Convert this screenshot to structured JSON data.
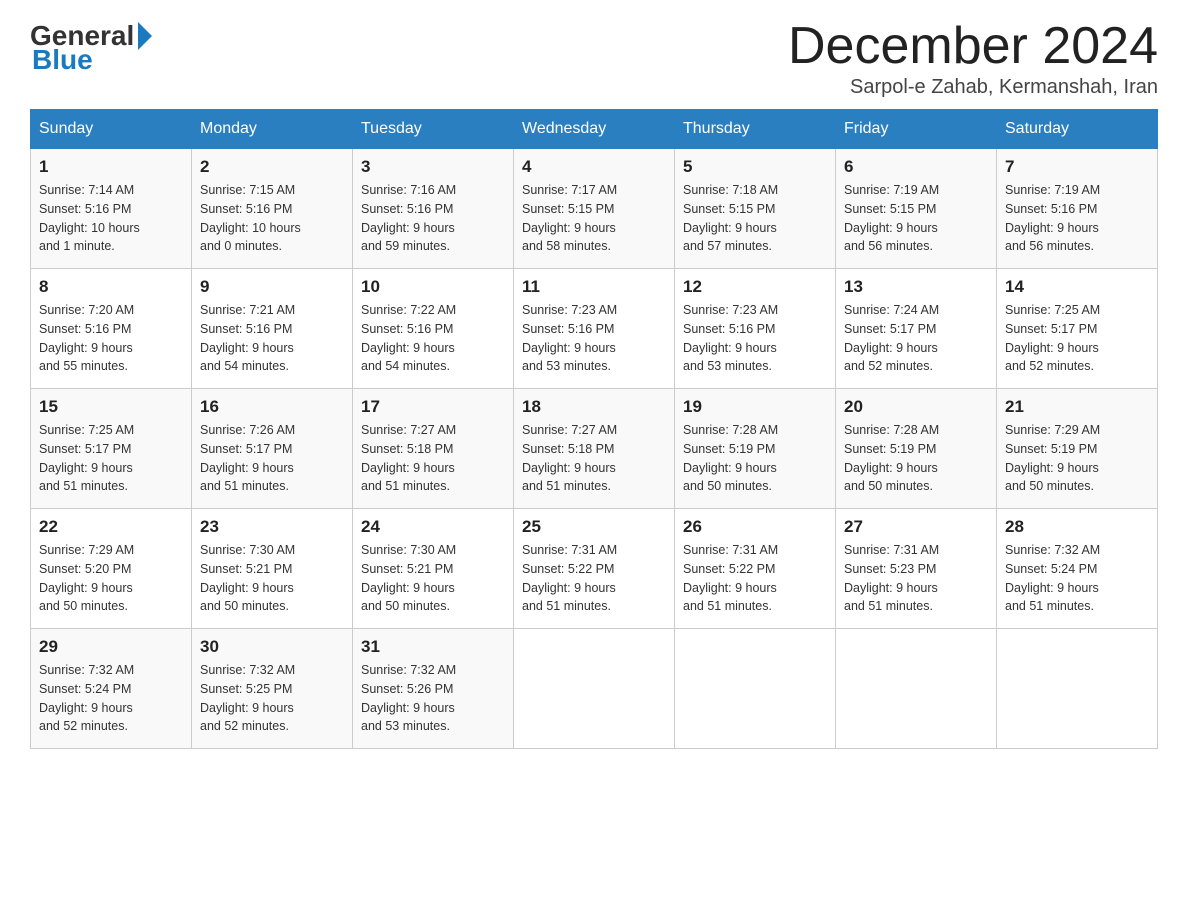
{
  "logo": {
    "general": "General",
    "blue": "Blue"
  },
  "header": {
    "month_year": "December 2024",
    "location": "Sarpol-e Zahab, Kermanshah, Iran"
  },
  "days_of_week": [
    "Sunday",
    "Monday",
    "Tuesday",
    "Wednesday",
    "Thursday",
    "Friday",
    "Saturday"
  ],
  "weeks": [
    [
      {
        "day": "1",
        "sunrise": "7:14 AM",
        "sunset": "5:16 PM",
        "daylight": "10 hours and 1 minute."
      },
      {
        "day": "2",
        "sunrise": "7:15 AM",
        "sunset": "5:16 PM",
        "daylight": "10 hours and 0 minutes."
      },
      {
        "day": "3",
        "sunrise": "7:16 AM",
        "sunset": "5:16 PM",
        "daylight": "9 hours and 59 minutes."
      },
      {
        "day": "4",
        "sunrise": "7:17 AM",
        "sunset": "5:15 PM",
        "daylight": "9 hours and 58 minutes."
      },
      {
        "day": "5",
        "sunrise": "7:18 AM",
        "sunset": "5:15 PM",
        "daylight": "9 hours and 57 minutes."
      },
      {
        "day": "6",
        "sunrise": "7:19 AM",
        "sunset": "5:15 PM",
        "daylight": "9 hours and 56 minutes."
      },
      {
        "day": "7",
        "sunrise": "7:19 AM",
        "sunset": "5:16 PM",
        "daylight": "9 hours and 56 minutes."
      }
    ],
    [
      {
        "day": "8",
        "sunrise": "7:20 AM",
        "sunset": "5:16 PM",
        "daylight": "9 hours and 55 minutes."
      },
      {
        "day": "9",
        "sunrise": "7:21 AM",
        "sunset": "5:16 PM",
        "daylight": "9 hours and 54 minutes."
      },
      {
        "day": "10",
        "sunrise": "7:22 AM",
        "sunset": "5:16 PM",
        "daylight": "9 hours and 54 minutes."
      },
      {
        "day": "11",
        "sunrise": "7:23 AM",
        "sunset": "5:16 PM",
        "daylight": "9 hours and 53 minutes."
      },
      {
        "day": "12",
        "sunrise": "7:23 AM",
        "sunset": "5:16 PM",
        "daylight": "9 hours and 53 minutes."
      },
      {
        "day": "13",
        "sunrise": "7:24 AM",
        "sunset": "5:17 PM",
        "daylight": "9 hours and 52 minutes."
      },
      {
        "day": "14",
        "sunrise": "7:25 AM",
        "sunset": "5:17 PM",
        "daylight": "9 hours and 52 minutes."
      }
    ],
    [
      {
        "day": "15",
        "sunrise": "7:25 AM",
        "sunset": "5:17 PM",
        "daylight": "9 hours and 51 minutes."
      },
      {
        "day": "16",
        "sunrise": "7:26 AM",
        "sunset": "5:17 PM",
        "daylight": "9 hours and 51 minutes."
      },
      {
        "day": "17",
        "sunrise": "7:27 AM",
        "sunset": "5:18 PM",
        "daylight": "9 hours and 51 minutes."
      },
      {
        "day": "18",
        "sunrise": "7:27 AM",
        "sunset": "5:18 PM",
        "daylight": "9 hours and 51 minutes."
      },
      {
        "day": "19",
        "sunrise": "7:28 AM",
        "sunset": "5:19 PM",
        "daylight": "9 hours and 50 minutes."
      },
      {
        "day": "20",
        "sunrise": "7:28 AM",
        "sunset": "5:19 PM",
        "daylight": "9 hours and 50 minutes."
      },
      {
        "day": "21",
        "sunrise": "7:29 AM",
        "sunset": "5:19 PM",
        "daylight": "9 hours and 50 minutes."
      }
    ],
    [
      {
        "day": "22",
        "sunrise": "7:29 AM",
        "sunset": "5:20 PM",
        "daylight": "9 hours and 50 minutes."
      },
      {
        "day": "23",
        "sunrise": "7:30 AM",
        "sunset": "5:21 PM",
        "daylight": "9 hours and 50 minutes."
      },
      {
        "day": "24",
        "sunrise": "7:30 AM",
        "sunset": "5:21 PM",
        "daylight": "9 hours and 50 minutes."
      },
      {
        "day": "25",
        "sunrise": "7:31 AM",
        "sunset": "5:22 PM",
        "daylight": "9 hours and 51 minutes."
      },
      {
        "day": "26",
        "sunrise": "7:31 AM",
        "sunset": "5:22 PM",
        "daylight": "9 hours and 51 minutes."
      },
      {
        "day": "27",
        "sunrise": "7:31 AM",
        "sunset": "5:23 PM",
        "daylight": "9 hours and 51 minutes."
      },
      {
        "day": "28",
        "sunrise": "7:32 AM",
        "sunset": "5:24 PM",
        "daylight": "9 hours and 51 minutes."
      }
    ],
    [
      {
        "day": "29",
        "sunrise": "7:32 AM",
        "sunset": "5:24 PM",
        "daylight": "9 hours and 52 minutes."
      },
      {
        "day": "30",
        "sunrise": "7:32 AM",
        "sunset": "5:25 PM",
        "daylight": "9 hours and 52 minutes."
      },
      {
        "day": "31",
        "sunrise": "7:32 AM",
        "sunset": "5:26 PM",
        "daylight": "9 hours and 53 minutes."
      },
      null,
      null,
      null,
      null
    ]
  ],
  "labels": {
    "sunrise": "Sunrise:",
    "sunset": "Sunset:",
    "daylight": "Daylight:"
  }
}
